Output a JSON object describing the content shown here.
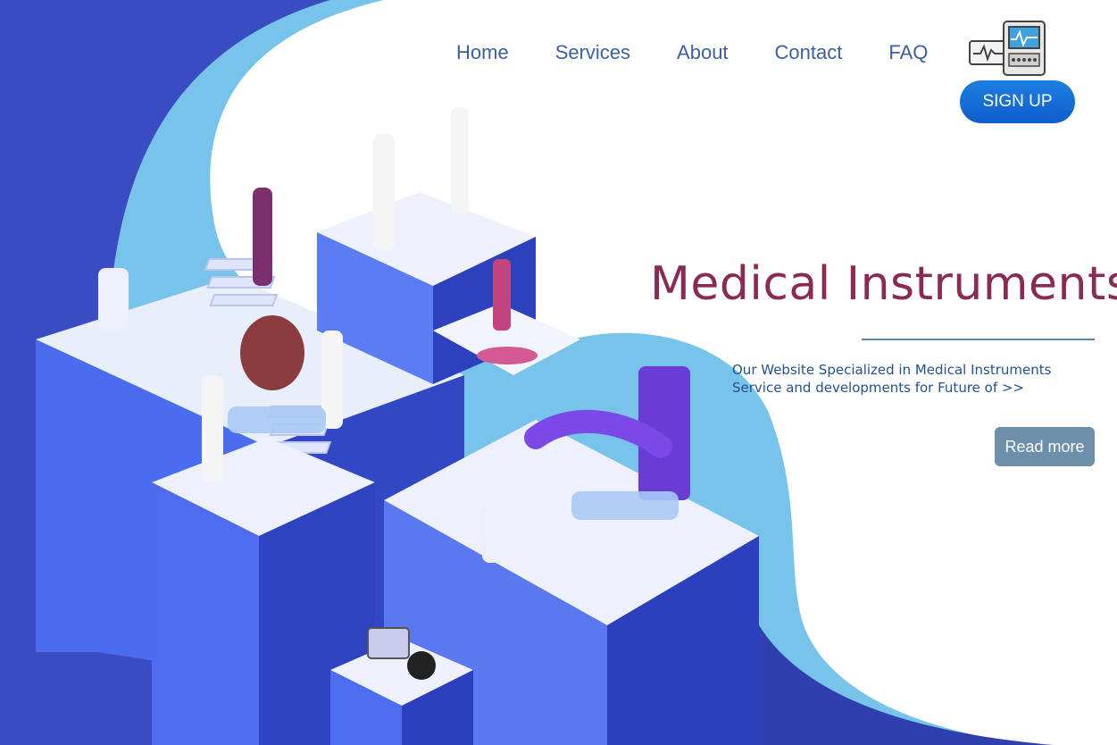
{
  "nav": {
    "items": [
      "Home",
      "Services",
      "About",
      "Contact",
      "FAQ"
    ]
  },
  "header": {
    "logo_icon": "medical-monitor-icon",
    "signup_label": "SIGN UP"
  },
  "hero": {
    "title": "Medical Instruments",
    "description_line1": "Our Website Specialized in Medical Instruments",
    "description_line2": "Service and developments for Future of >>",
    "read_more_label": "Read more"
  },
  "colors": {
    "primary_blue": "#3e5fa4",
    "title_maroon": "#8a2b55",
    "button_blue": "#1570dc",
    "read_more_gray": "#6e8fa9",
    "illustration_blue": "#3d4fc6"
  }
}
